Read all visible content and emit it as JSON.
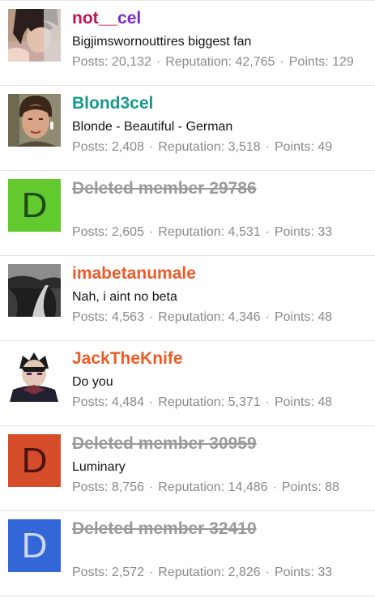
{
  "labels": {
    "posts": "Posts:",
    "reputation": "Reputation:",
    "points": "Points:",
    "separator": "·"
  },
  "members": [
    {
      "username": "not__cel",
      "name_color": "#c0134f",
      "name_color_2": "#7a2cc9",
      "title": "Bigjimswornouttires biggest fan",
      "posts": "20,132",
      "reputation": "42,765",
      "points": "129",
      "avatar": "photo-person-icon"
    },
    {
      "username": "Blond3cel",
      "name_color": "#15998f",
      "title": "Blonde - Beautiful - German",
      "posts": "2,408",
      "reputation": "3,518",
      "points": "49",
      "avatar": "photo-person-icon"
    },
    {
      "username": "Deleted member 29786",
      "deleted": true,
      "title": "",
      "posts": "2,605",
      "reputation": "4,531",
      "points": "33",
      "avatar_letter": "D",
      "avatar_bg": "#62c92f",
      "avatar_fg": "#1f4a0f"
    },
    {
      "username": "imabetanumale",
      "name_color": "#ef5a28",
      "title": "Nah, i aint no beta",
      "posts": "4,563",
      "reputation": "4,346",
      "points": "48",
      "avatar": "photo-road-icon"
    },
    {
      "username": "JackTheKnife",
      "name_color": "#ef5a28",
      "title": "Do you",
      "posts": "4,484",
      "reputation": "5,371",
      "points": "48",
      "avatar": "anime-character-icon"
    },
    {
      "username": "Deleted member 30959",
      "deleted": true,
      "title": "Luminary",
      "posts": "8,756",
      "reputation": "14,486",
      "points": "88",
      "avatar_letter": "D",
      "avatar_bg": "#d54d2b",
      "avatar_fg": "#4b140a"
    },
    {
      "username": "Deleted member 32410",
      "deleted": true,
      "title": "",
      "posts": "2,572",
      "reputation": "2,826",
      "points": "33",
      "avatar_letter": "D",
      "avatar_bg": "#3366d6",
      "avatar_fg": "#c9d8f6"
    }
  ]
}
